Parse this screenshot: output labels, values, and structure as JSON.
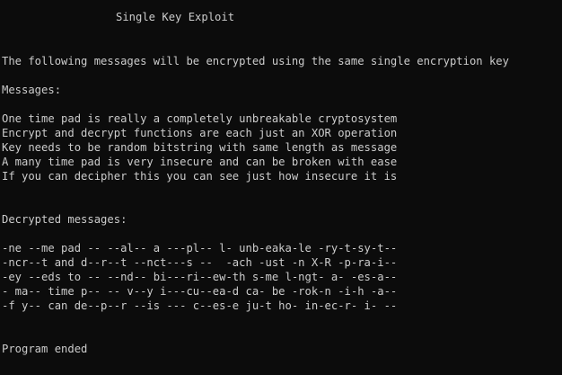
{
  "window": {
    "background_color": "#0c0c0c",
    "text_color": "#cccccc"
  },
  "console": {
    "title": "Single Key Exploit",
    "intro": "The following messages will be encrypted using the same single encryption key",
    "messages_heading": "Messages:",
    "messages": [
      "One time pad is really a completely unbreakable cryptosystem",
      "Encrypt and decrypt functions are each just an XOR operation",
      "Key needs to be random bitstring with same length as message",
      "A many time pad is very insecure and can be broken with ease",
      "If you can decipher this you can see just how insecure it is"
    ],
    "decrypted_heading": "Decrypted messages:",
    "decrypted": [
      "-ne --me pad -- --al-- a ---pl-- l- unb-eaka-le -ry-t-sy-t--",
      "-ncr--t and d--r--t --nct---s --  -ach -ust -n X-R -p-ra-i--",
      "-ey --eds to -- --nd-- bi---ri--ew-th s-me l-ngt- a- -es-a--",
      "- ma-- time p-- -- v--y i---cu--ea-d ca- be -rok-n -i-h -a--",
      "-f y-- can de--p--r --is --- c--es-e ju-t ho- in-ec-r- i- --"
    ],
    "footer": "Program ended"
  }
}
